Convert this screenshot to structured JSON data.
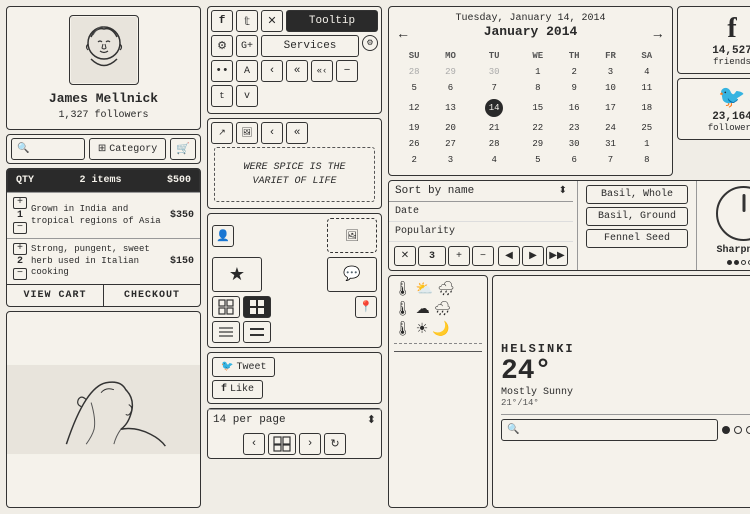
{
  "profile": {
    "name": "James Mellnick",
    "followers": "1,327 followers"
  },
  "toolbar": {
    "tooltip_label": "Tooltip",
    "services_label": "Services"
  },
  "spice_quote": "WERE SPICE IS THE VARIET OF LIFE",
  "cart": {
    "qty_label": "QTY",
    "items_count": "2 items",
    "total": "$500",
    "item1": {
      "num": "1",
      "desc": "Grown in India and tropical regions of Asia",
      "price": "$350"
    },
    "item2": {
      "num": "2",
      "desc": "Strong, pungent, sweet herb used in Italian cooking",
      "price": "$150"
    },
    "view_cart": "VIEW CART",
    "checkout": "CHECKOUT"
  },
  "search": {
    "placeholder": "🔍",
    "category_label": "Category"
  },
  "per_page": {
    "label": "14 per page"
  },
  "calendar": {
    "date_label": "Tuesday, January 14, 2014",
    "month_label": "January 2014",
    "days": [
      "SU",
      "MO",
      "TU",
      "WE",
      "TH",
      "FR",
      "SA"
    ],
    "weeks": [
      [
        "28",
        "29",
        "30",
        "1",
        "2",
        "3",
        "4"
      ],
      [
        "5",
        "6",
        "7",
        "8",
        "9",
        "10",
        "11"
      ],
      [
        "12",
        "13",
        "14",
        "15",
        "16",
        "17",
        "18"
      ],
      [
        "19",
        "20",
        "21",
        "22",
        "23",
        "24",
        "25"
      ],
      [
        "26",
        "27",
        "28",
        "29",
        "30",
        "31",
        "1"
      ],
      [
        "2",
        "3",
        "4",
        "5",
        "6",
        "7",
        "8"
      ]
    ],
    "today": "14"
  },
  "facebook": {
    "count": "14,527",
    "label": "friends"
  },
  "twitter": {
    "count": "23,164",
    "label": "followers"
  },
  "sort": {
    "label": "Sort by name",
    "item1": "Date",
    "item2": "Popularity"
  },
  "spices": {
    "item1": "Basil, Whole",
    "item2": "Basil, Ground",
    "item3": "Fennel Seed"
  },
  "knob": {
    "label": "Sharpness"
  },
  "control": {
    "num": "3"
  },
  "helsinki": {
    "city": "HELSINKI",
    "temp": "24°",
    "desc": "Mostly Sunny",
    "range": "21°/14°"
  },
  "bottom_search": {
    "placeholder": "🔍"
  }
}
